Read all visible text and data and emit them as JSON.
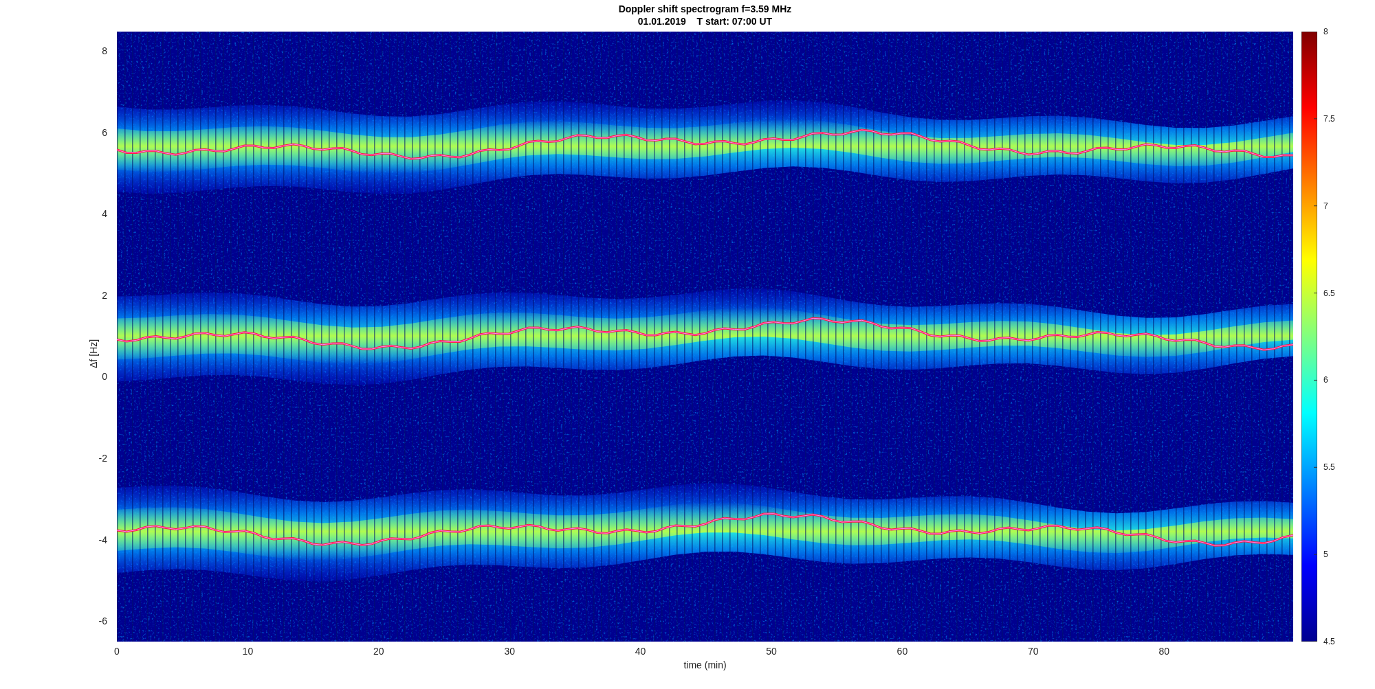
{
  "figure": {
    "title": [
      "Doppler shift spectrogram f=3.59 MHz",
      "01.01.2019    T start: 07:00 UT"
    ],
    "ylabel": "Δf [Hz]",
    "xlabel": "time (min)",
    "yticks": [
      "8",
      "6",
      "4",
      "2",
      "0",
      "-2",
      "-4",
      "-6"
    ],
    "xticks": [
      "0",
      "10",
      "20",
      "30",
      "40",
      "50",
      "60",
      "70",
      "80"
    ],
    "colorbar_ticks": [
      "8",
      "7.5",
      "7",
      "6.5",
      "6",
      "5.5",
      "5",
      "4.5"
    ]
  }
}
